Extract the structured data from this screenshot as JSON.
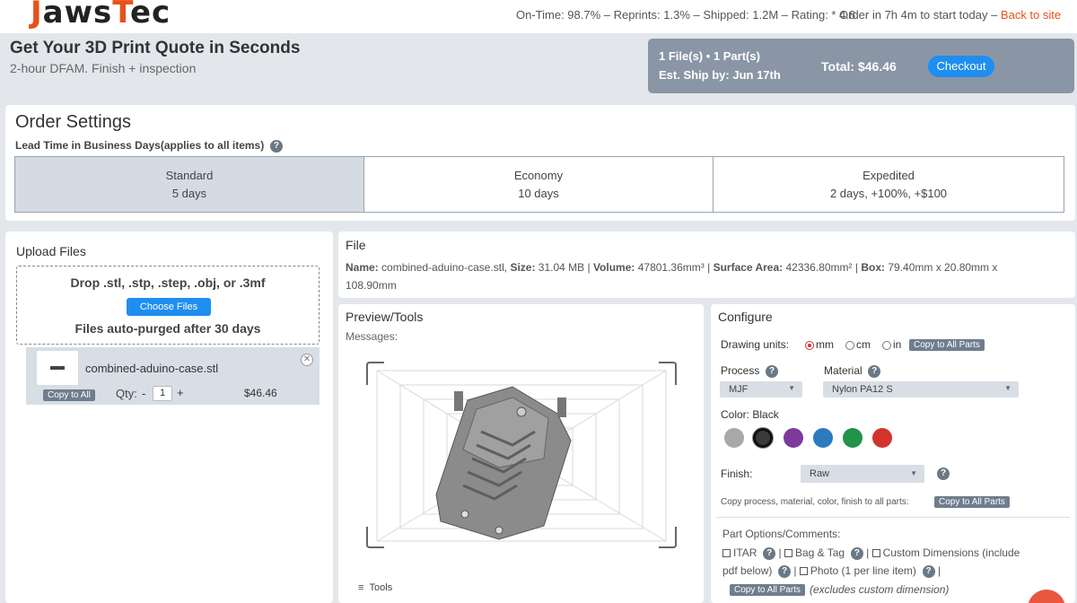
{
  "brand": {
    "logo_text_a": "J",
    "logo_text_b": "aws",
    "logo_text_c": "T",
    "logo_text_d": "ec"
  },
  "topbar": {
    "stats": "On-Time: 98.7% – Reprints: 1.3% – Shipped: 1.2M – Rating: * 4.8",
    "order_in": "Order in 7h 4m to start today – ",
    "back_link": "Back to site"
  },
  "hero": {
    "title": "Get Your 3D Print Quote in Seconds",
    "subtitle": "2-hour DFAM. Finish + inspection"
  },
  "summary": {
    "files": "1 File(s) • 1 Part(s)",
    "ship": "Est. Ship by: Jun 17th",
    "total": "Total: $46.46",
    "checkout": "Checkout"
  },
  "order_settings": {
    "title": "Order Settings",
    "lead_label": "Lead Time in Business Days(applies to all items)",
    "help": "?",
    "options": [
      {
        "name": "Standard",
        "detail": "5 days"
      },
      {
        "name": "Economy",
        "detail": "10 days"
      },
      {
        "name": "Expedited",
        "detail": "2 days, +100%, +$100"
      }
    ]
  },
  "upload": {
    "title": "Upload Files",
    "drop_text": "Drop .stl, .stp, .step, .obj, or .3mf",
    "choose_button": "Choose Files",
    "purge_text": "Files auto-purged after 30 days",
    "file": {
      "name": "combined-aduino-case.stl",
      "copy_all": "Copy to All",
      "qty_label": "Qty:",
      "qty_minus": "-",
      "qty_value": "1",
      "qty_plus": "+",
      "price": "$46.46",
      "close": "✕"
    }
  },
  "file_panel": {
    "title": "File",
    "name_label": "Name:",
    "name_value": " combined-aduino-case.stl, ",
    "size_label": "Size:",
    "size_value": " 31.04 MB | ",
    "volume_label": "Volume:",
    "volume_value": " 47801.36mm³ | ",
    "surface_label": "Surface Area:",
    "surface_value": " 42336.80mm² | ",
    "box_label": "Box:",
    "box_value": " 79.40mm x 20.80mm x 108.90mm"
  },
  "preview": {
    "title": "Preview/Tools",
    "messages": "Messages:",
    "tools": "Tools"
  },
  "configure": {
    "title": "Configure",
    "drawing_units_label": "Drawing units:",
    "units": [
      "mm",
      "cm",
      "in"
    ],
    "selected_unit": "mm",
    "copy_all_parts": "Copy to All Parts",
    "process_label": "Process",
    "process_value": "MJF",
    "material_label": "Material",
    "material_value": "Nylon PA12 S",
    "color_label": "Color: Black",
    "colors": [
      "#a8a8a8",
      "#3a3a3a",
      "#7d3a9b",
      "#2d7bbf",
      "#22934a",
      "#d2342c"
    ],
    "selected_color_index": 1,
    "finish_label": "Finish:",
    "finish_value": "Raw",
    "copy_line": "Copy process, material, color, finish to all parts:",
    "part_options_label": "Part Options/Comments:",
    "opt_itar": "ITAR",
    "opt_bag": "Bag & Tag",
    "opt_custom": "Custom Dimensions (include",
    "opt_custom_2": "pdf below)",
    "opt_photo": "Photo (1 per line item)",
    "excludes": "(excludes custom dimension)",
    "sep": "|"
  }
}
